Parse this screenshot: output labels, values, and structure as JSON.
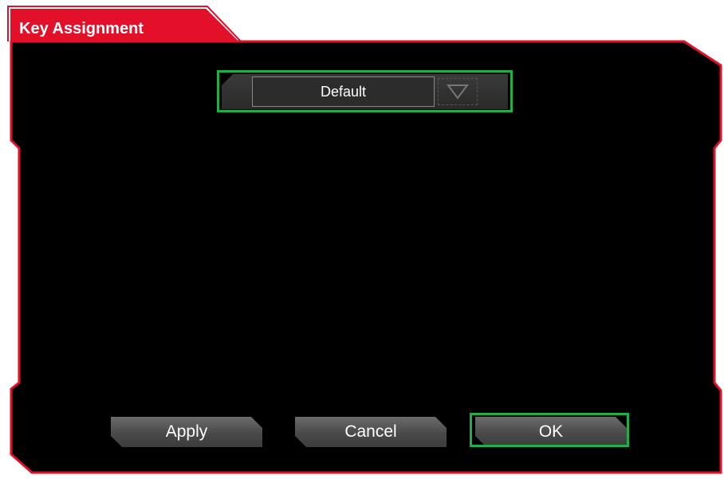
{
  "window": {
    "title": "Key Assignment"
  },
  "profile_dropdown": {
    "selected": "Default",
    "arrow_icon": "triangle-down-icon"
  },
  "buttons": {
    "apply_label": "Apply",
    "cancel_label": "Cancel",
    "ok_label": "OK"
  },
  "colors": {
    "accent_red": "#e3102a",
    "highlight_green": "#1fae4a",
    "background": "#000000"
  }
}
